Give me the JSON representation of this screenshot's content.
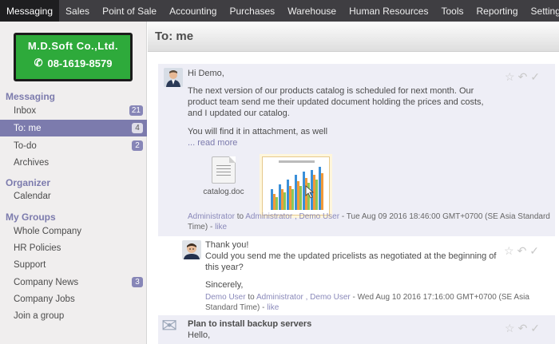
{
  "topnav": [
    {
      "label": "Messaging",
      "active": true
    },
    {
      "label": "Sales"
    },
    {
      "label": "Point of Sale"
    },
    {
      "label": "Accounting"
    },
    {
      "label": "Purchases"
    },
    {
      "label": "Warehouse"
    },
    {
      "label": "Human Resources"
    },
    {
      "label": "Tools"
    },
    {
      "label": "Reporting"
    },
    {
      "label": "Settings"
    }
  ],
  "logo": {
    "line1": "M.D.Soft Co.,Ltd.",
    "line2": "08-1619-8579"
  },
  "sidebar": {
    "messaging_title": "Messaging",
    "inbox": {
      "label": "Inbox",
      "count": "21"
    },
    "to_me": {
      "label": "To: me",
      "count": "4"
    },
    "todo": {
      "label": "To-do",
      "count": "2"
    },
    "archives": "Archives",
    "organizer_title": "Organizer",
    "calendar": "Calendar",
    "groups_title": "My Groups",
    "whole_company": "Whole Company",
    "hr_policies": "HR Policies",
    "support": "Support",
    "company_news": {
      "label": "Company News",
      "count": "3"
    },
    "company_jobs": "Company Jobs",
    "join_group": "Join a group"
  },
  "header": {
    "title": "To: me"
  },
  "messages": [
    {
      "greeting": "Hi Demo,",
      "body1": "The next version of our products catalog is scheduled for next month. Our product team send me their updated document holding the prices and costs, and I updated our catalog.",
      "body2": "You will find it in attachment, as well",
      "read_more": "... read more",
      "attachment": "catalog.doc",
      "author": "Administrator",
      "to": "to",
      "recipients": "Administrator , Demo User",
      "date": "- Tue Aug 09 2016 18:46:00 GMT+0700 (SE Asia Standard Time) -",
      "like": "like"
    },
    {
      "line1": "Thank you!",
      "line2": "Could you send me the updated pricelists as negotiated at the beginning of this year?",
      "line3": "Sincerely,",
      "author": "Demo User",
      "to": "to",
      "recipients": "Administrator , Demo User",
      "date": "- Wed Aug 10 2016 17:16:00 GMT+0700 (SE Asia Standard Time) -",
      "like": "like"
    },
    {
      "subject": "Plan to install backup servers",
      "greeting": "Hello,"
    }
  ],
  "icons": {
    "star": "☆",
    "reply": "↶",
    "check": "✓",
    "envelope": "✉",
    "phone": "✆"
  }
}
